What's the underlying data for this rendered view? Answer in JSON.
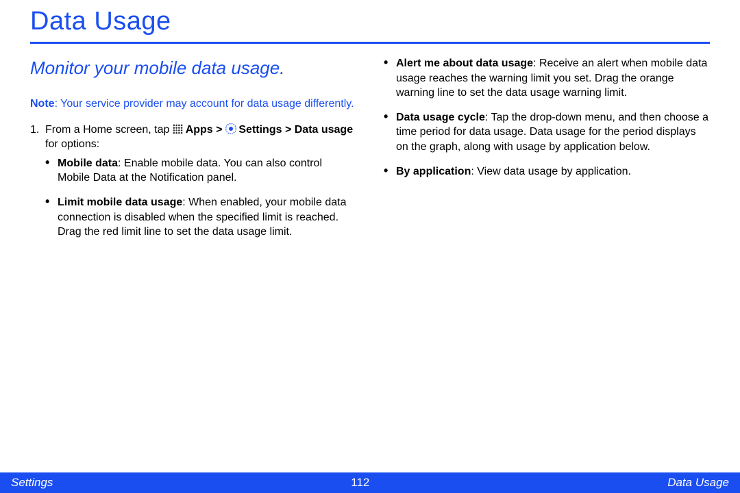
{
  "title": "Data Usage",
  "subtitle": "Monitor your mobile data usage.",
  "note_label": "Note",
  "note_text": ": Your service provider may account for data usage differently.",
  "step_num": "1.",
  "step_prefix": "From a Home screen, tap ",
  "apps_label": " Apps > ",
  "settings_label": " Settings > ",
  "data_usage_bold": "Data usage",
  "step_tail": " for options:",
  "left_bullets": [
    {
      "bold": "Mobile data",
      "text": ": Enable mobile data. You can also control Mobile Data at the Notification panel."
    },
    {
      "bold": "Limit mobile data usage",
      "text": ": When enabled, your mobile data connection is disabled when the specified limit is reached. Drag the red limit line to set the data usage limit."
    }
  ],
  "right_bullets": [
    {
      "bold": "Alert me about data usage",
      "text": ": Receive an alert when mobile data usage reaches the warning limit you set. Drag the orange warning line to set the data usage warning limit."
    },
    {
      "bold": "Data usage cycle",
      "text": ": Tap the drop-down menu, and then choose a time period for data usage. Data usage for the period displays on the graph, along with usage by application below."
    },
    {
      "bold": "By application",
      "text": ": View data usage by application."
    }
  ],
  "footer": {
    "left": "Settings",
    "center": "112",
    "right": "Data Usage"
  }
}
